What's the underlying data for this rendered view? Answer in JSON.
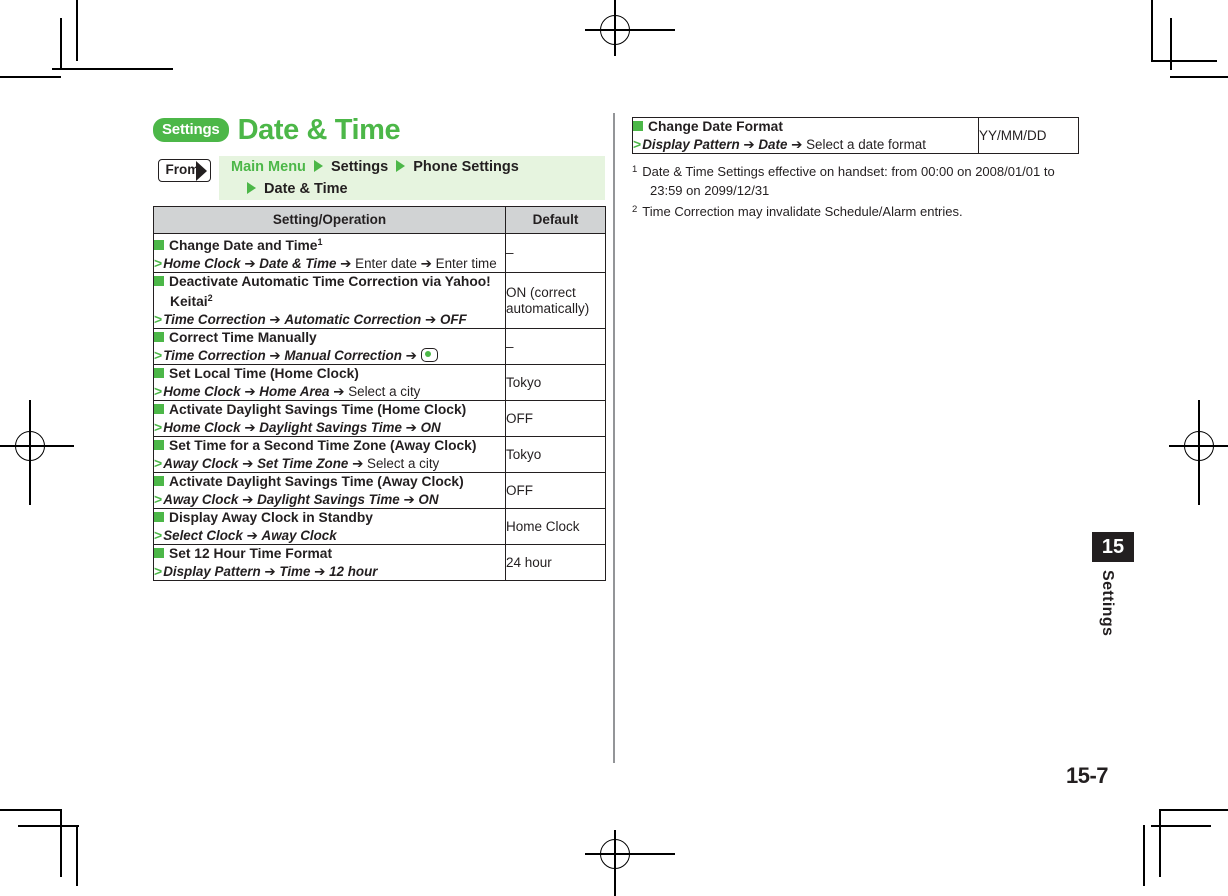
{
  "header": {
    "badge": "Settings",
    "title": "Date & Time"
  },
  "from": {
    "label": "From",
    "crumbs_line1": [
      "Main Menu",
      "Settings",
      "Phone Settings"
    ],
    "crumbs_line2": [
      "Date & Time"
    ]
  },
  "table": {
    "columns": [
      "Setting/Operation",
      "Default"
    ],
    "rows": [
      {
        "title": "Change Date and Time",
        "title_sup": "1",
        "path": [
          {
            "t": "Home Clock",
            "s": "i"
          },
          {
            "t": "➔",
            "s": "a"
          },
          {
            "t": "Date & Time",
            "s": "i"
          },
          {
            "t": "➔",
            "s": "a"
          },
          {
            "t": "Enter date",
            "s": "p"
          },
          {
            "t": "➔",
            "s": "a"
          },
          {
            "t": "Enter time",
            "s": "p"
          }
        ],
        "default": "–"
      },
      {
        "title": "Deactivate Automatic Time Correction via Yahoo! Keitai",
        "title_sup": "2",
        "path": [
          {
            "t": "Time Correction",
            "s": "i"
          },
          {
            "t": "➔",
            "s": "a"
          },
          {
            "t": "Automatic Correction",
            "s": "i"
          },
          {
            "t": "➔",
            "s": "a"
          },
          {
            "t": "OFF",
            "s": "i"
          }
        ],
        "default": "ON (correct automatically)"
      },
      {
        "title": "Correct Time Manually",
        "title_sup": "",
        "path": [
          {
            "t": "Time Correction",
            "s": "i"
          },
          {
            "t": "➔",
            "s": "a"
          },
          {
            "t": "Manual Correction",
            "s": "i"
          },
          {
            "t": "➔",
            "s": "a"
          },
          {
            "t": "",
            "s": "key"
          }
        ],
        "default": "–"
      },
      {
        "title": "Set Local Time (Home Clock)",
        "title_sup": "",
        "path": [
          {
            "t": "Home Clock",
            "s": "i"
          },
          {
            "t": "➔",
            "s": "a"
          },
          {
            "t": "Home Area",
            "s": "i"
          },
          {
            "t": "➔",
            "s": "a"
          },
          {
            "t": "Select a city",
            "s": "p"
          }
        ],
        "default": "Tokyo"
      },
      {
        "title": "Activate Daylight Savings Time (Home Clock)",
        "title_sup": "",
        "path": [
          {
            "t": "Home Clock",
            "s": "i"
          },
          {
            "t": "➔",
            "s": "a"
          },
          {
            "t": "Daylight Savings Time",
            "s": "i"
          },
          {
            "t": "➔",
            "s": "a"
          },
          {
            "t": "ON",
            "s": "i"
          }
        ],
        "default": "OFF"
      },
      {
        "title": "Set Time for a Second Time Zone (Away Clock)",
        "title_sup": "",
        "path": [
          {
            "t": "Away Clock",
            "s": "i"
          },
          {
            "t": "➔",
            "s": "a"
          },
          {
            "t": "Set Time Zone",
            "s": "i"
          },
          {
            "t": "➔",
            "s": "a"
          },
          {
            "t": "Select a city",
            "s": "p"
          }
        ],
        "default": "Tokyo"
      },
      {
        "title": "Activate Daylight Savings Time (Away Clock)",
        "title_sup": "",
        "path": [
          {
            "t": "Away Clock",
            "s": "i"
          },
          {
            "t": "➔",
            "s": "a"
          },
          {
            "t": "Daylight Savings Time",
            "s": "i"
          },
          {
            "t": "➔",
            "s": "a"
          },
          {
            "t": "ON",
            "s": "i"
          }
        ],
        "default": "OFF"
      },
      {
        "title": "Display Away Clock in Standby",
        "title_sup": "",
        "path": [
          {
            "t": "Select Clock",
            "s": "i"
          },
          {
            "t": "➔",
            "s": "a"
          },
          {
            "t": "Away Clock",
            "s": "i"
          }
        ],
        "default": "Home Clock"
      },
      {
        "title": "Set 12 Hour Time Format",
        "title_sup": "",
        "path": [
          {
            "t": "Display Pattern",
            "s": "i"
          },
          {
            "t": "➔",
            "s": "a"
          },
          {
            "t": "Time",
            "s": "i"
          },
          {
            "t": "➔",
            "s": "a"
          },
          {
            "t": "12 hour",
            "s": "i"
          }
        ],
        "default": "24 hour"
      }
    ]
  },
  "table_right": {
    "rows": [
      {
        "title": "Change Date Format",
        "title_sup": "",
        "path": [
          {
            "t": "Display Pattern",
            "s": "i"
          },
          {
            "t": "➔",
            "s": "a"
          },
          {
            "t": "Date",
            "s": "i"
          },
          {
            "t": "➔",
            "s": "a"
          },
          {
            "t": "Select a date format",
            "s": "p"
          }
        ],
        "default": "YY/MM/DD"
      }
    ]
  },
  "footnotes": [
    {
      "num": "1",
      "text": "Date & Time Settings effective on handset: from 00:00 on 2008/01/01 to 23:59 on 2099/12/31"
    },
    {
      "num": "2",
      "text": "Time Correction may invalidate Schedule/Alarm entries."
    }
  ],
  "side_tab": {
    "number": "15",
    "label": "Settings"
  },
  "folio": "15-7",
  "colors": {
    "green": "#4cb748",
    "band": "#e6f4df",
    "header_gray": "#d1d3d4",
    "ink": "#231f20",
    "divider": "#939598"
  }
}
